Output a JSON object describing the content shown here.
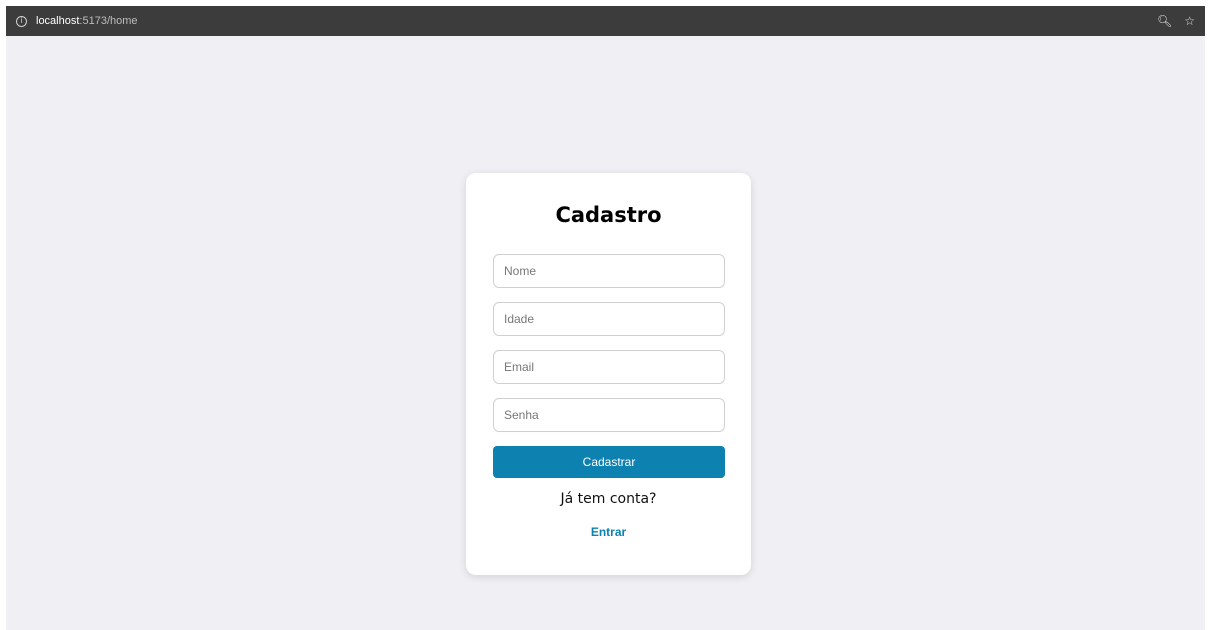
{
  "browser": {
    "url_host": "localhost",
    "url_path": ":5173/home",
    "info_icon": "info-icon",
    "zoom_icon": "zoom-icon",
    "bookmark_icon": "star-icon"
  },
  "form": {
    "title": "Cadastro",
    "fields": [
      {
        "placeholder": "Nome",
        "value": ""
      },
      {
        "placeholder": "Idade",
        "value": ""
      },
      {
        "placeholder": "Email",
        "value": ""
      },
      {
        "placeholder": "Senha",
        "value": ""
      }
    ],
    "submit_label": "Cadastrar",
    "account_question": "Já tem conta?",
    "login_link": "Entrar"
  },
  "colors": {
    "accent": "#0d82b0",
    "page_background": "#f0f0f4",
    "url_bar": "#3c3c3c"
  }
}
